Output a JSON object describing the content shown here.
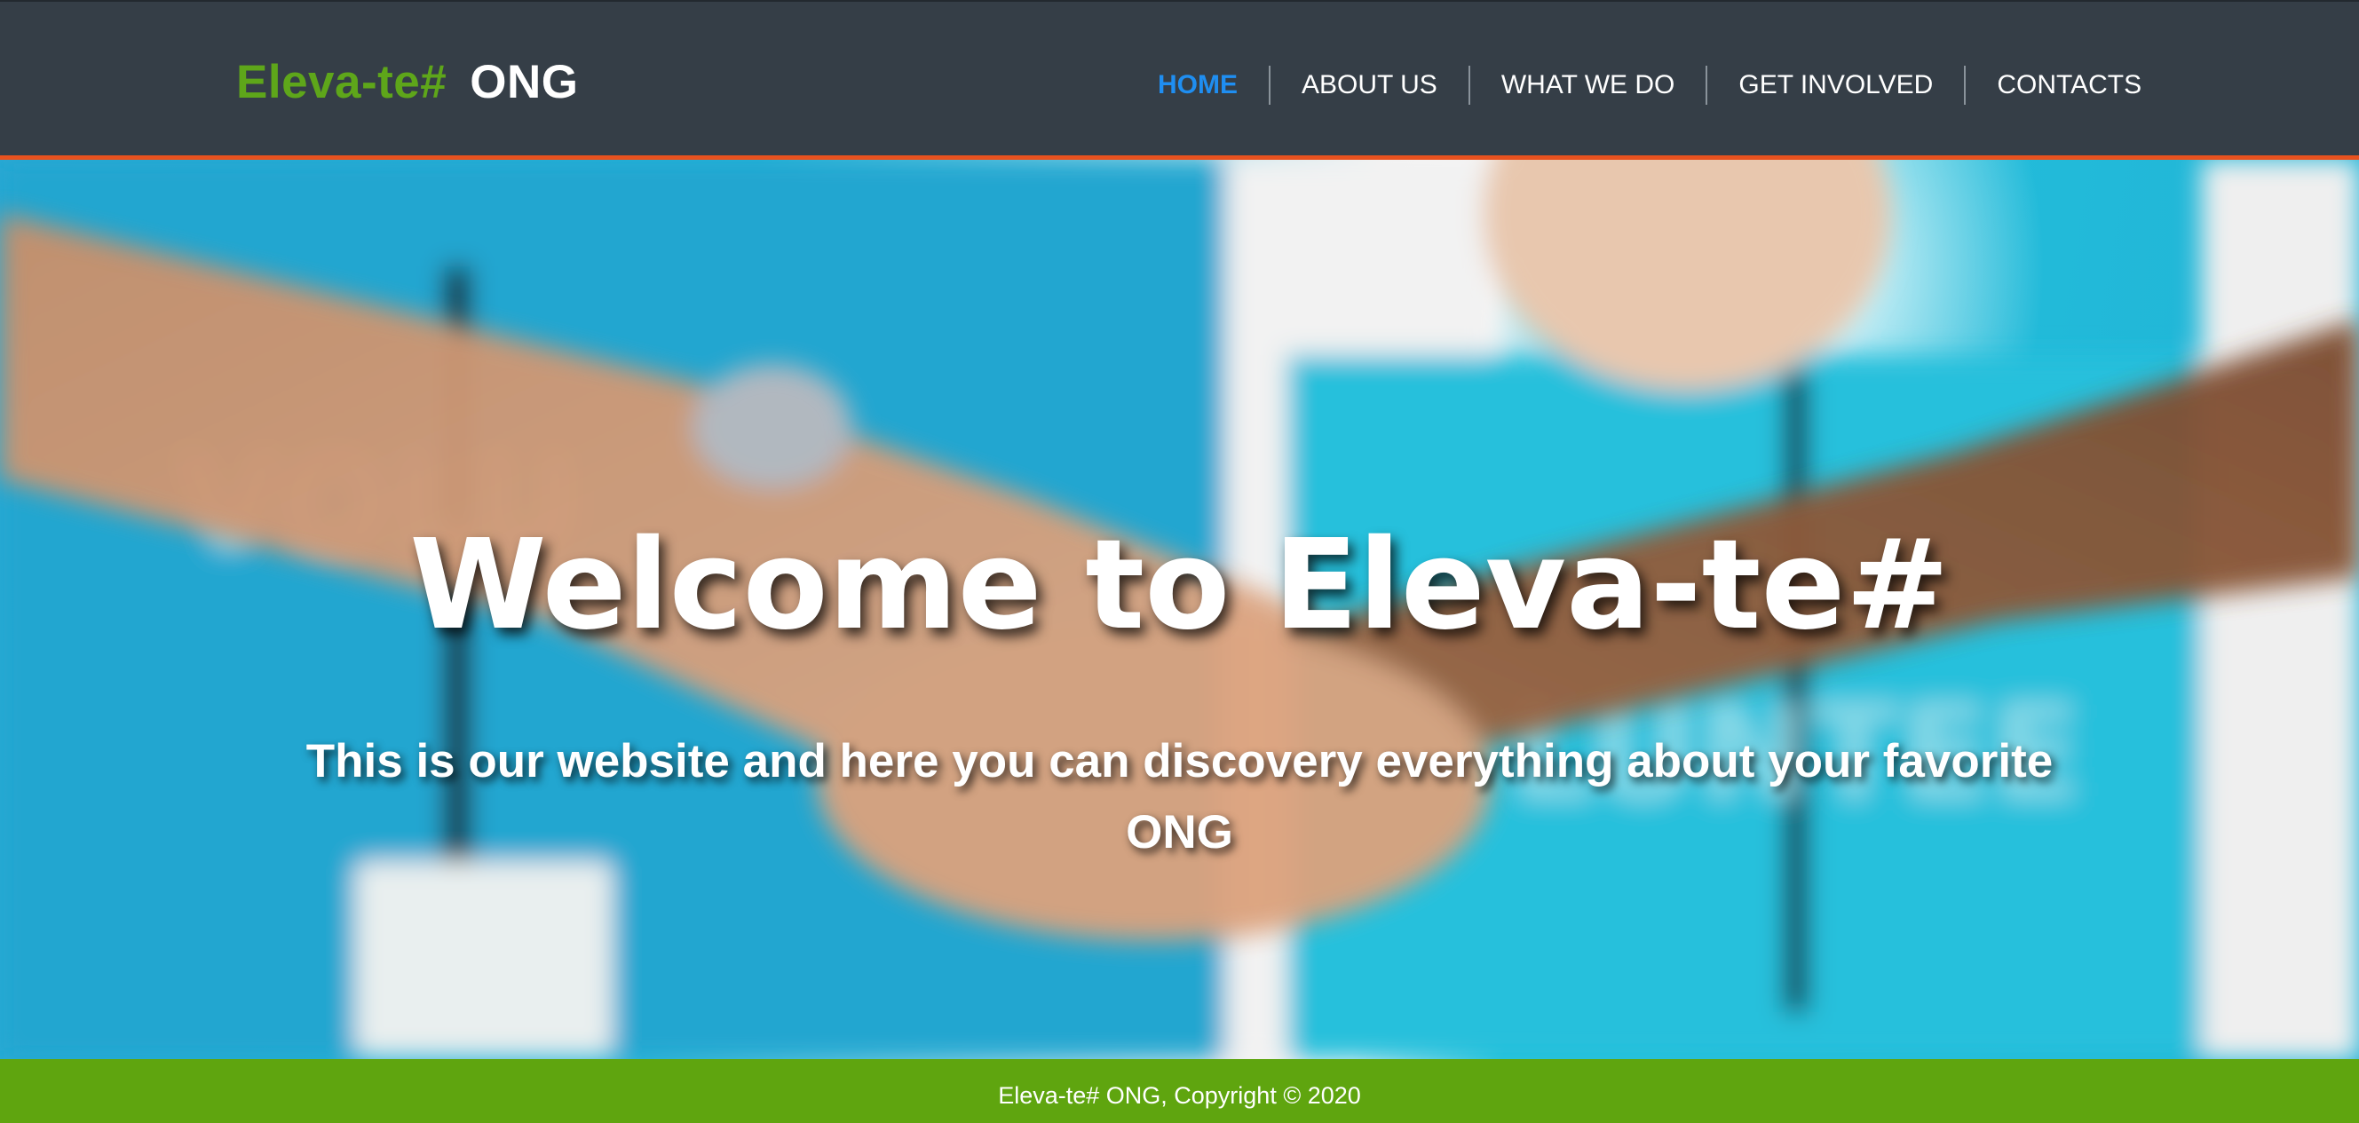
{
  "logo": {
    "brand": "Eleva-te#",
    "suffix": "ONG"
  },
  "nav": {
    "items": [
      {
        "label": "HOME",
        "active": true
      },
      {
        "label": "ABOUT US",
        "active": false
      },
      {
        "label": "WHAT WE DO",
        "active": false
      },
      {
        "label": "GET INVOLVED",
        "active": false
      },
      {
        "label": "CONTACTS",
        "active": false
      }
    ]
  },
  "hero": {
    "title": "Welcome to Eleva-te#",
    "subtitle": "This is our website and here you can discovery everything about your favorite ONG",
    "image": "volunteers-hands-together-photo"
  },
  "footer": {
    "text": "Eleva-te# ONG, Copyright © 2020"
  },
  "colors": {
    "header_bg": "#353e47",
    "accent_border": "#e8521f",
    "brand_green": "#5ea61a",
    "nav_active": "#1f8ef1",
    "footer_bg": "#5fa50f"
  }
}
